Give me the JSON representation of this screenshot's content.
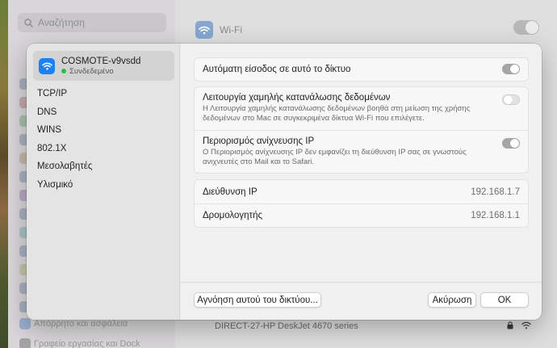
{
  "background": {
    "search_placeholder": "Αναζήτηση",
    "wifi_label": "Wi-Fi",
    "sidebar_bottom_items": [
      "Απόρρητο και ασφάλεια",
      "Γραφείο εργασίας και Dock"
    ],
    "printer_name": "DIRECT-27-HP DeskJet 4670 series"
  },
  "sheet": {
    "network": {
      "name": "COSMOTE-v9vsdd",
      "status": "Συνδεδεμένο",
      "status_color": "#2fbe44",
      "icon": "wifi-icon"
    },
    "sidebar_items": [
      "TCP/IP",
      "DNS",
      "WINS",
      "802.1X",
      "Μεσολαβητές",
      "Υλισμικό"
    ],
    "auto_join": {
      "label": "Αυτόματη είσοδος σε αυτό το δίκτυο",
      "enabled": true
    },
    "low_data": {
      "label": "Λειτουργία χαμηλής κατανάλωσης δεδομένων",
      "description": "Η Λειτουργία χαμηλής κατανάλωσης δεδομένων βοηθά στη μείωση της χρήσης δεδομένων στο Mac σε συγκεκριμένα δίκτυα Wi-Fi που επιλέγετε.",
      "enabled": false
    },
    "limit_tracking": {
      "label": "Περιορισμός ανίχνευσης IP",
      "description": "Ο Περιορισμός ανίχνευσης IP δεν εμφανίζει τη διεύθυνση IP σας σε γνωστούς ανιχνευτές στο Mail και το Safari.",
      "enabled": true
    },
    "ip_address": {
      "label": "Διεύθυνση IP",
      "value": "192.168.1.7"
    },
    "router": {
      "label": "Δρομολογητής",
      "value": "192.168.1.1"
    },
    "buttons": {
      "forget": "Αγνόηση αυτού του δικτύου...",
      "cancel": "Ακύρωση",
      "ok": "OK"
    }
  }
}
